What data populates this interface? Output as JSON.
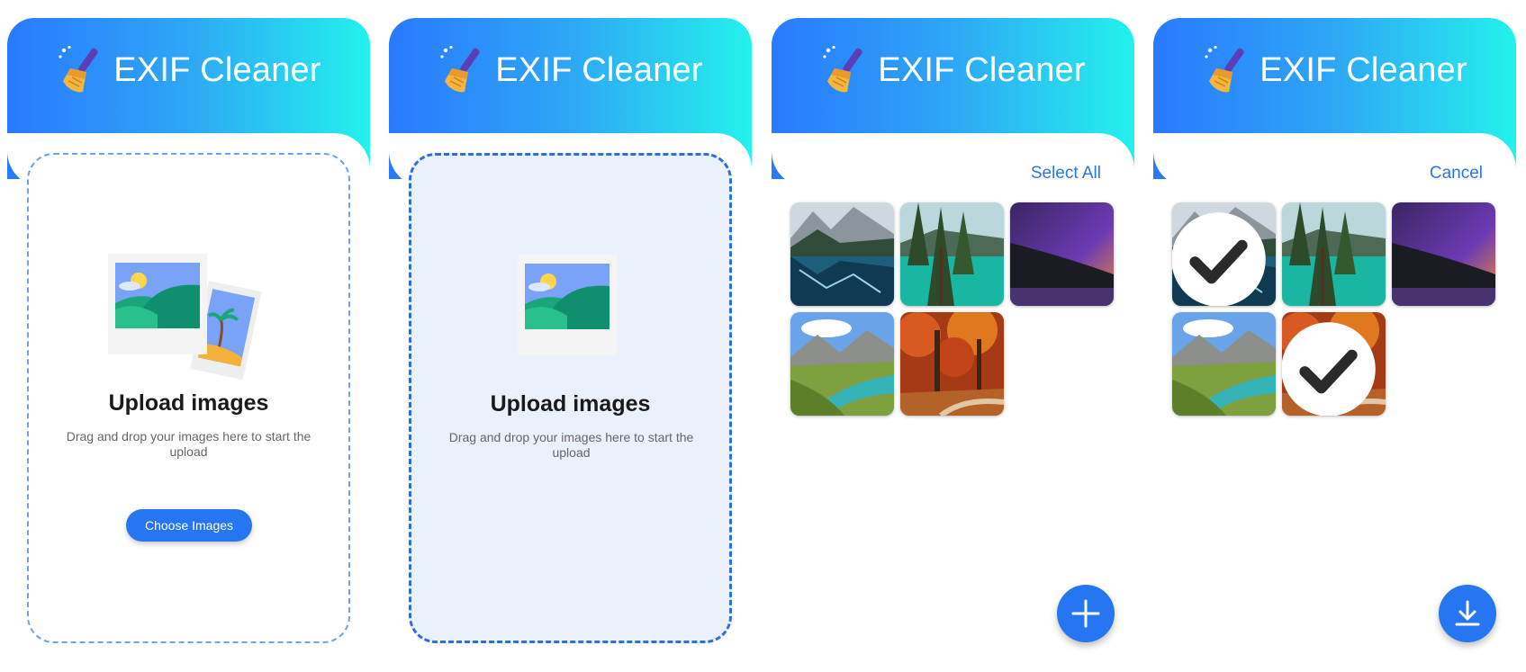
{
  "app": {
    "title": "EXIF Cleaner",
    "icon": "broom-icon"
  },
  "screens": [
    {
      "state": "empty",
      "upload": {
        "title": "Upload images",
        "description": "Drag and drop your images here to start the upload",
        "button": "Choose Images"
      }
    },
    {
      "state": "dragging",
      "upload": {
        "title": "Upload images",
        "description": "Drag and drop your images here to start the upload"
      }
    },
    {
      "state": "gallery",
      "header_action": "Select All",
      "fab_icon": "plus-icon",
      "images": [
        {
          "name": "mountain-lake",
          "selected": false
        },
        {
          "name": "forest-lake",
          "selected": false
        },
        {
          "name": "purple-sunset",
          "selected": false
        },
        {
          "name": "alpine-valley",
          "selected": false
        },
        {
          "name": "autumn-forest",
          "selected": false
        }
      ]
    },
    {
      "state": "selecting",
      "header_action": "Cancel",
      "fab_icon": "download-icon",
      "images": [
        {
          "name": "mountain-lake",
          "selected": true
        },
        {
          "name": "forest-lake",
          "selected": false
        },
        {
          "name": "purple-sunset",
          "selected": false
        },
        {
          "name": "alpine-valley",
          "selected": false
        },
        {
          "name": "autumn-forest",
          "selected": true
        }
      ]
    }
  ],
  "colors": {
    "accent": "#2576f0",
    "gradient_start": "#2979ff",
    "gradient_end": "#24f1ec",
    "dropzone_active_bg": "#eaf1fd"
  }
}
